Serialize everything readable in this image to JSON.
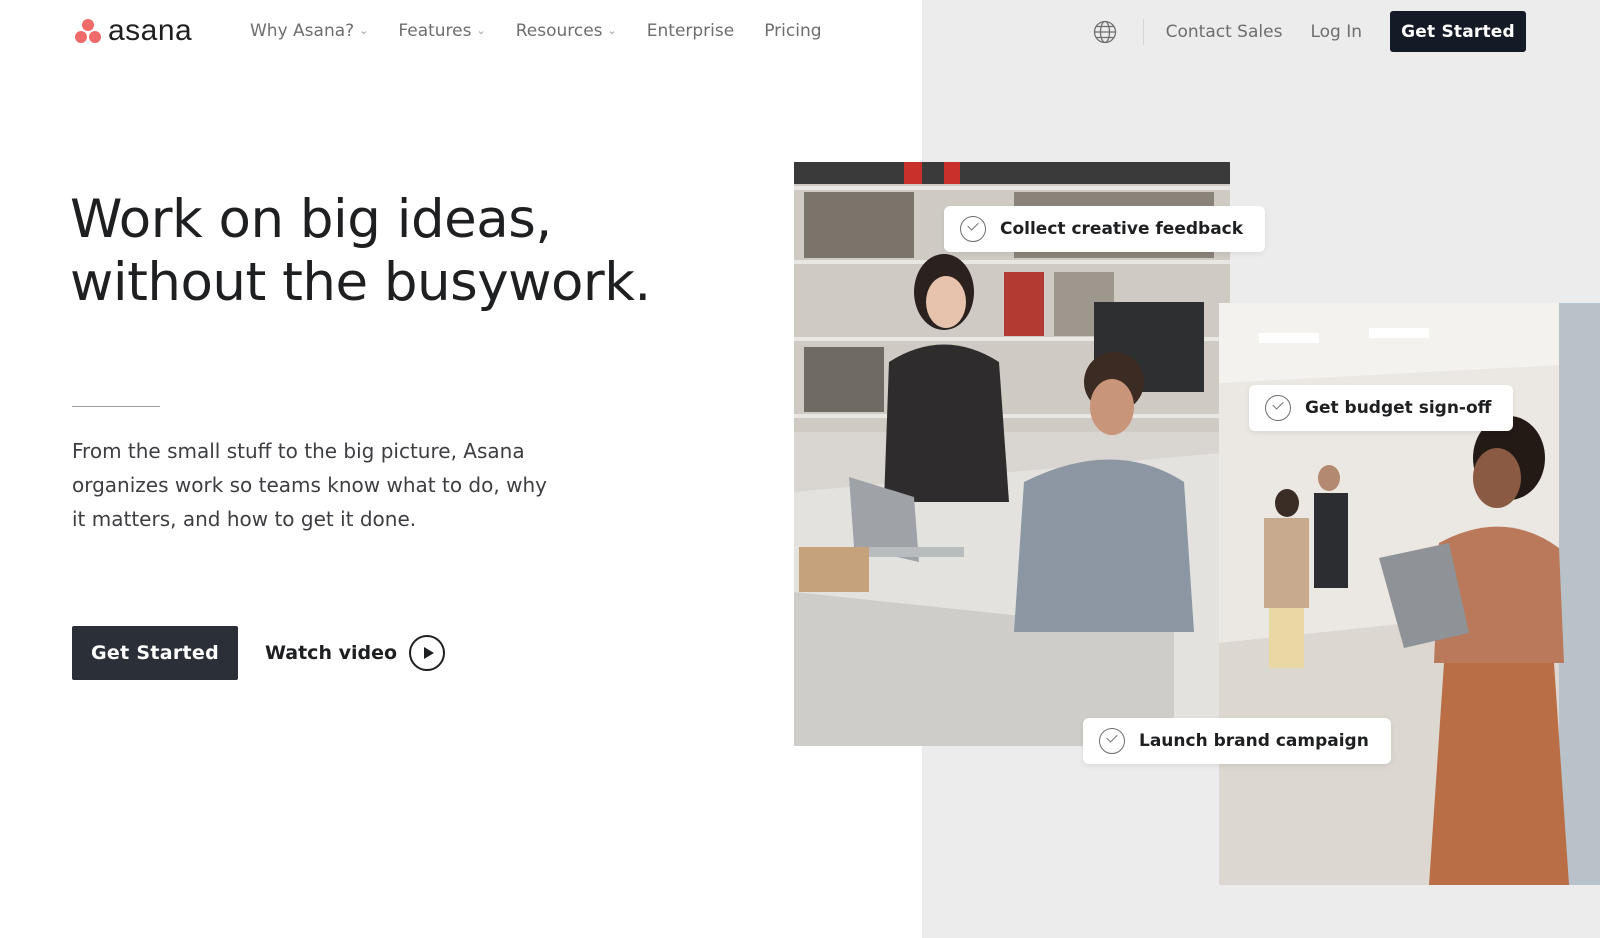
{
  "brand": {
    "logo_text": "asana",
    "accent": "#f06a6a"
  },
  "nav": {
    "links": [
      {
        "label": "Why Asana?",
        "dropdown": true
      },
      {
        "label": "Features",
        "dropdown": true
      },
      {
        "label": "Resources",
        "dropdown": true
      },
      {
        "label": "Enterprise",
        "dropdown": false
      },
      {
        "label": "Pricing",
        "dropdown": false
      }
    ],
    "contact_sales": "Contact Sales",
    "log_in": "Log In",
    "get_started": "Get Started"
  },
  "hero": {
    "title_line1": "Work on big ideas,",
    "title_line2": "without the busywork.",
    "description": "From the small stuff to the big picture, Asana organizes work so teams know what to do, why it matters, and how to get it done.",
    "cta": "Get Started",
    "watch_video": "Watch video"
  },
  "tags": [
    {
      "label": "Collect creative feedback"
    },
    {
      "label": "Get budget sign-off"
    },
    {
      "label": "Launch brand campaign"
    }
  ],
  "icons": [
    "globe-icon",
    "play-icon",
    "check-circle-icon",
    "chevron-down-icon"
  ]
}
